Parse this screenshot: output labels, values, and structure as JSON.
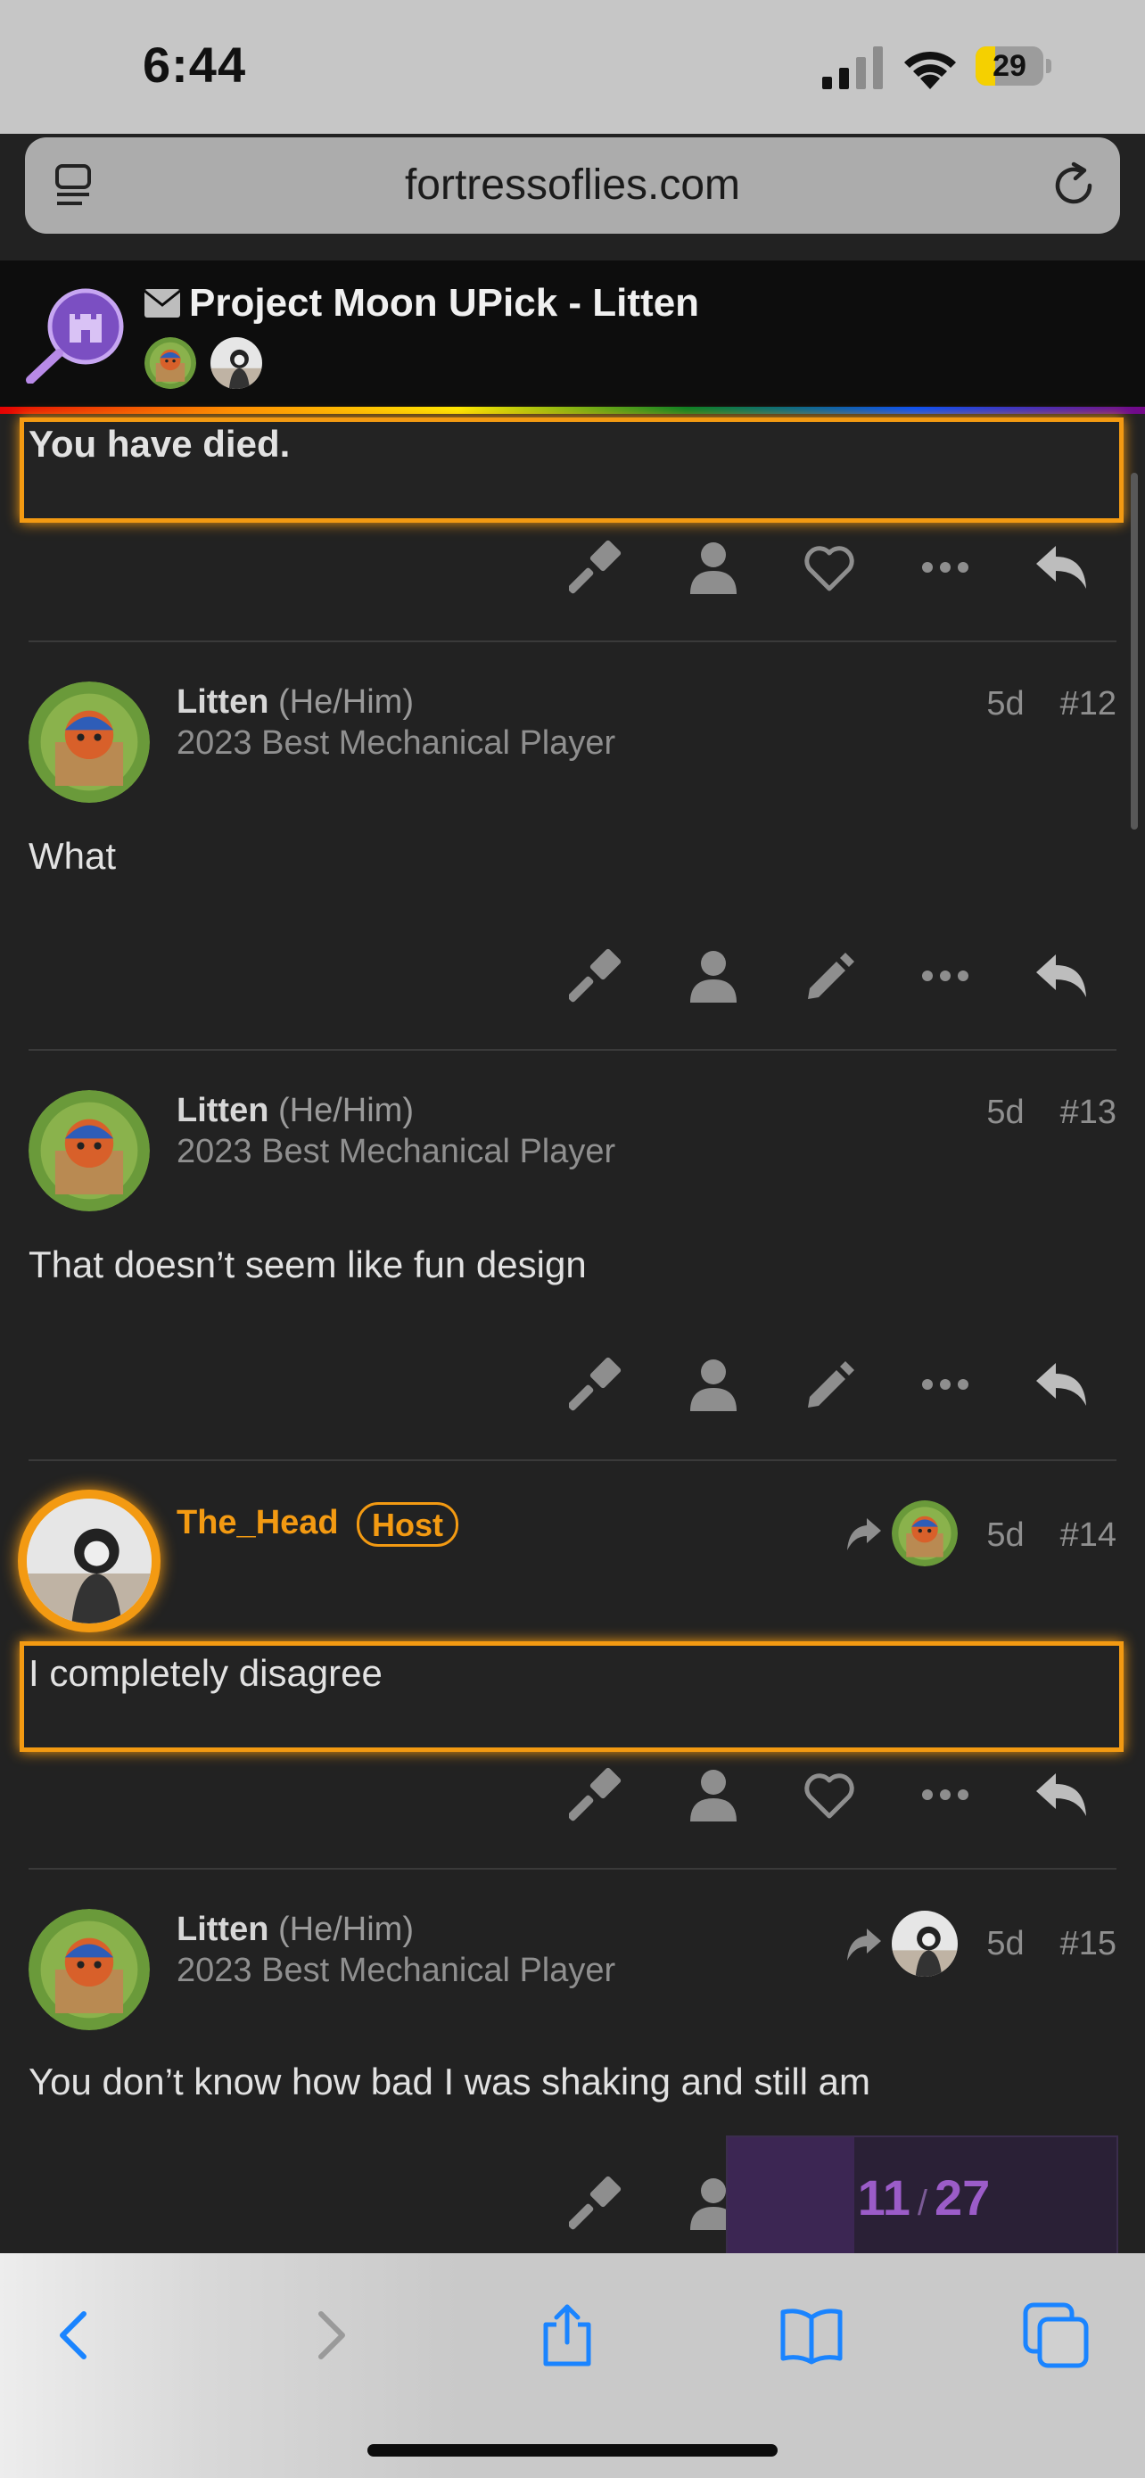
{
  "status_bar": {
    "time": "6:44",
    "battery": "29",
    "battery_level": 0.29
  },
  "browser": {
    "url": "fortressoflies.com"
  },
  "topic": {
    "title": "Project Moon UPick - Litten"
  },
  "posts": [
    {
      "body": "You have died."
    },
    {
      "author": "Litten",
      "pronouns": "(He/Him)",
      "user_title": "2023 Best Mechanical Player",
      "age": "5d",
      "number": "#12",
      "body": "What"
    },
    {
      "author": "Litten",
      "pronouns": "(He/Him)",
      "user_title": "2023 Best Mechanical Player",
      "age": "5d",
      "number": "#13",
      "body": "That doesn’t seem like fun design"
    },
    {
      "author": "The_Head",
      "badge": "Host",
      "age": "5d",
      "number": "#14",
      "body": "I completely disagree"
    },
    {
      "author": "Litten",
      "pronouns": "(He/Him)",
      "user_title": "2023 Best Mechanical Player",
      "age": "5d",
      "number": "#15",
      "body": "You don’t know how bad I was shaking and still am"
    }
  ],
  "timeline": {
    "current": "11",
    "separator": "/",
    "total": "27"
  },
  "colors": {
    "host_accent": "#f39a12",
    "timeline_accent": "#9b5cc8",
    "ios_blue": "#1a84ff"
  },
  "icons": [
    "gavel-icon",
    "user-icon",
    "heart-icon",
    "edit-icon",
    "more-icon",
    "reply-icon",
    "share-arrow-icon",
    "back-icon",
    "forward-icon",
    "share-icon",
    "bookmarks-icon",
    "tabs-icon",
    "reload-icon",
    "mail-icon"
  ]
}
